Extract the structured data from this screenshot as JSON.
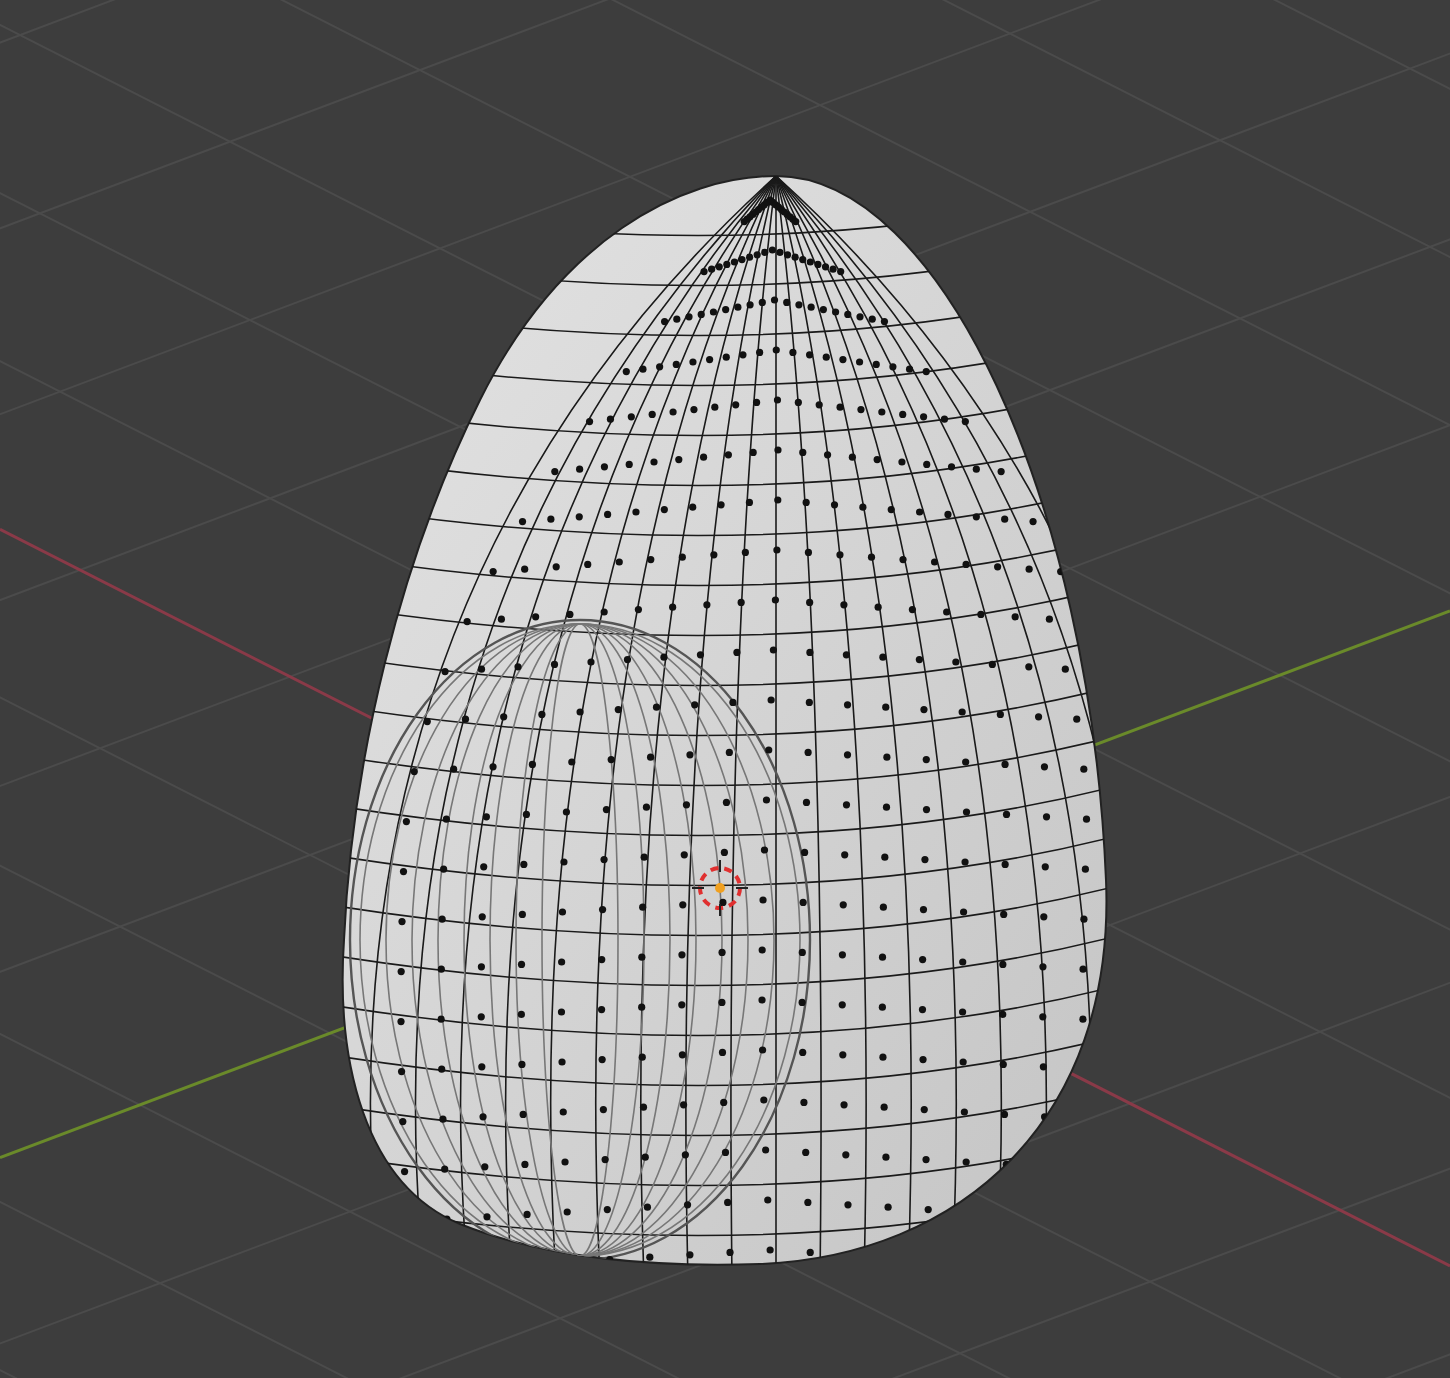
{
  "viewport": {
    "cursor_visible": true
  }
}
